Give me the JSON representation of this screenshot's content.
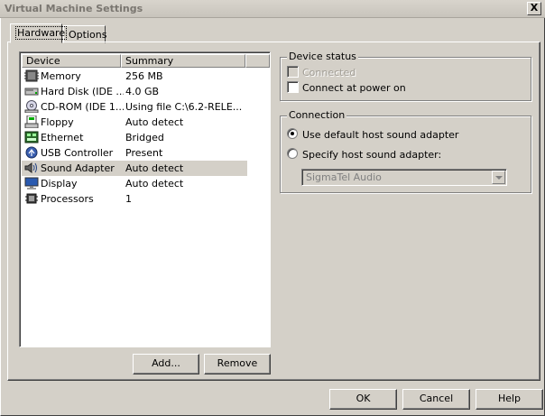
{
  "window": {
    "title": "Virtual Machine Settings",
    "close_glyph": "X"
  },
  "tabs": [
    {
      "label": "Hardware",
      "active": true
    },
    {
      "label": "Options",
      "active": false
    }
  ],
  "device_list": {
    "columns": [
      "Device",
      "Summary"
    ],
    "rows": [
      {
        "device": "Memory",
        "summary": "256 MB",
        "icon": "memory-icon",
        "selected": false
      },
      {
        "device": "Hard Disk (IDE ...",
        "summary": "4.0 GB",
        "icon": "hard-disk-icon",
        "selected": false
      },
      {
        "device": "CD-ROM (IDE 1...",
        "summary": "Using file C:\\6.2-RELE...",
        "icon": "cdrom-icon",
        "selected": false
      },
      {
        "device": "Floppy",
        "summary": "Auto detect",
        "icon": "floppy-icon",
        "selected": false
      },
      {
        "device": "Ethernet",
        "summary": "Bridged",
        "icon": "ethernet-icon",
        "selected": false
      },
      {
        "device": "USB Controller",
        "summary": "Present",
        "icon": "usb-icon",
        "selected": false
      },
      {
        "device": "Sound Adapter",
        "summary": "Auto detect",
        "icon": "speaker-icon",
        "selected": true
      },
      {
        "device": "Display",
        "summary": "Auto detect",
        "icon": "monitor-icon",
        "selected": false
      },
      {
        "device": "Processors",
        "summary": "1",
        "icon": "processor-icon",
        "selected": false
      }
    ]
  },
  "list_buttons": {
    "add": "Add...",
    "remove": "Remove"
  },
  "device_status": {
    "title": "Device status",
    "connected": {
      "label": "Connected",
      "checked": false,
      "disabled": true
    },
    "connect_at_power_on": {
      "label": "Connect at power on",
      "checked": false
    }
  },
  "connection": {
    "title": "Connection",
    "use_default": {
      "label": "Use default host sound adapter",
      "selected": true
    },
    "specify": {
      "label": "Specify host sound adapter:",
      "selected": false
    },
    "adapter_select": {
      "value": "SigmaTel Audio",
      "disabled": true
    }
  },
  "dialog_buttons": {
    "ok": "OK",
    "cancel": "Cancel",
    "help": "Help"
  }
}
